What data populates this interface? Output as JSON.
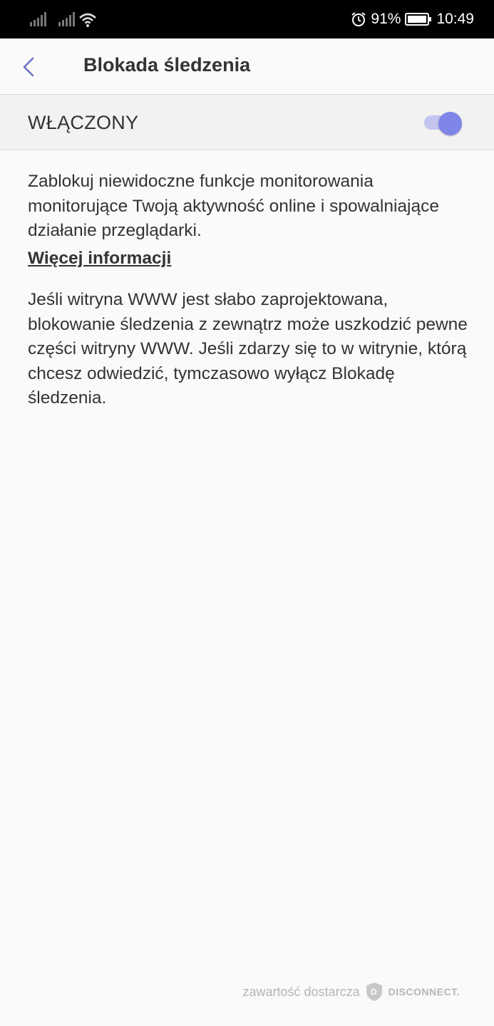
{
  "status_bar": {
    "battery_percent": "91%",
    "time": "10:49",
    "icons": [
      "signal-icon",
      "signal-icon",
      "wifi-icon",
      "alarm-icon",
      "battery-icon"
    ]
  },
  "header": {
    "title": "Blokada śledzenia",
    "back_icon": "chevron-left-icon"
  },
  "toggle": {
    "label": "WŁĄCZONY",
    "state": true,
    "accent_color": "#7e85e6"
  },
  "body": {
    "description": "Zablokuj niewidoczne funkcje monitorowania monitorujące Twoją aktywność online i spowalniające działanie przeglądarki.",
    "more_info_link": "Więcej informacji",
    "warning": "Jeśli witryna WWW jest słabo zaprojektowana, blokowanie śledzenia z zewnątrz może uszkodzić pewne części witryny WWW. Jeśli zdarzy się to w witrynie, którą chcesz odwiedzić, tymczasowo wyłącz Blokadę śledzenia."
  },
  "footer": {
    "provided_by": "zawartość dostarcza",
    "brand": "DISCONNECT."
  }
}
